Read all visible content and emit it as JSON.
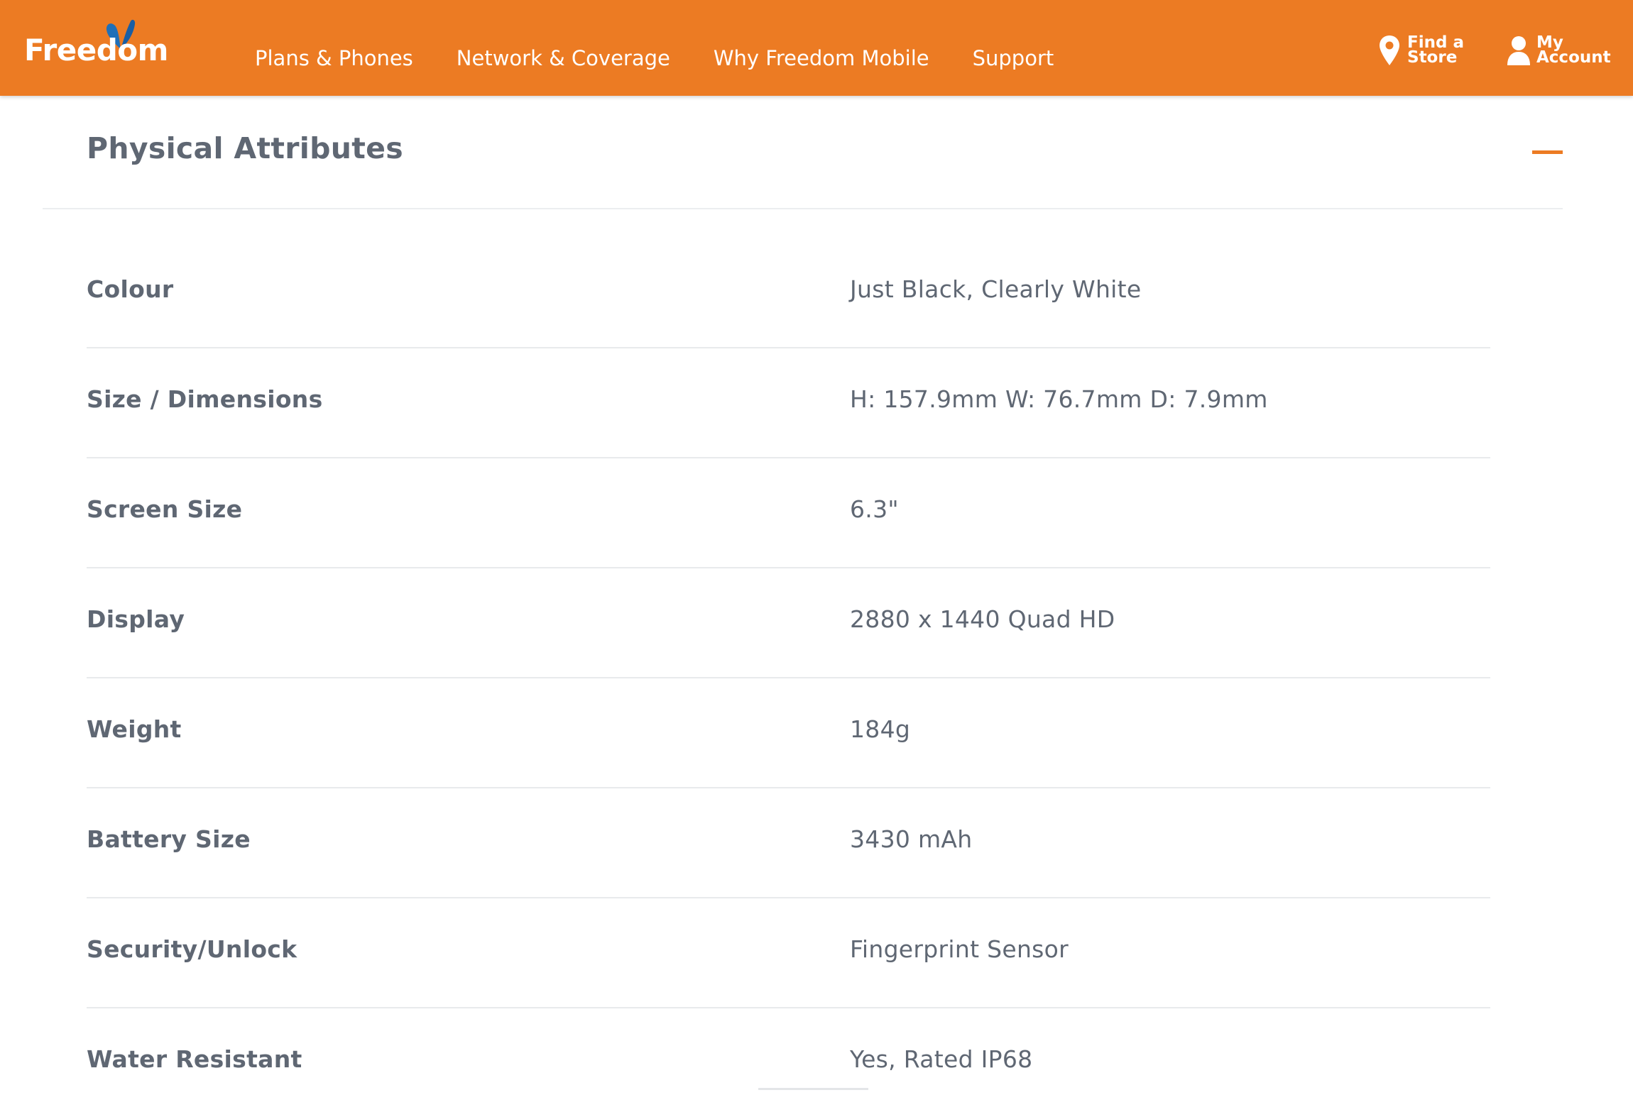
{
  "header": {
    "logo_text": "Freedom",
    "nav": [
      {
        "label": "Plans & Phones"
      },
      {
        "label": "Network & Coverage"
      },
      {
        "label": "Why Freedom Mobile"
      },
      {
        "label": "Support"
      }
    ],
    "find_store": {
      "label": "Find a Store",
      "icon": "location-pin-icon"
    },
    "account": {
      "label": "My Account",
      "icon": "user-icon"
    }
  },
  "section": {
    "title": "Physical Attributes",
    "collapse_icon": "minus-icon",
    "expanded": true
  },
  "specs": [
    {
      "label": "Colour",
      "value": "Just Black, Clearly White"
    },
    {
      "label": "Size / Dimensions",
      "value": "H: 157.9mm W: 76.7mm D: 7.9mm"
    },
    {
      "label": "Screen Size",
      "value": "6.3\""
    },
    {
      "label": "Display",
      "value": "2880 x 1440 Quad HD"
    },
    {
      "label": "Weight",
      "value": "184g"
    },
    {
      "label": "Battery Size",
      "value": "3430 mAh"
    },
    {
      "label": "Security/Unlock",
      "value": "Fingerprint Sensor"
    },
    {
      "label": "Water Resistant",
      "value": "Yes, Rated IP68"
    }
  ],
  "colors": {
    "brand_orange": "#ec7b23",
    "logo_blue": "#1f6fb8",
    "text_gray": "#5f6773",
    "divider": "#e8eaec"
  }
}
